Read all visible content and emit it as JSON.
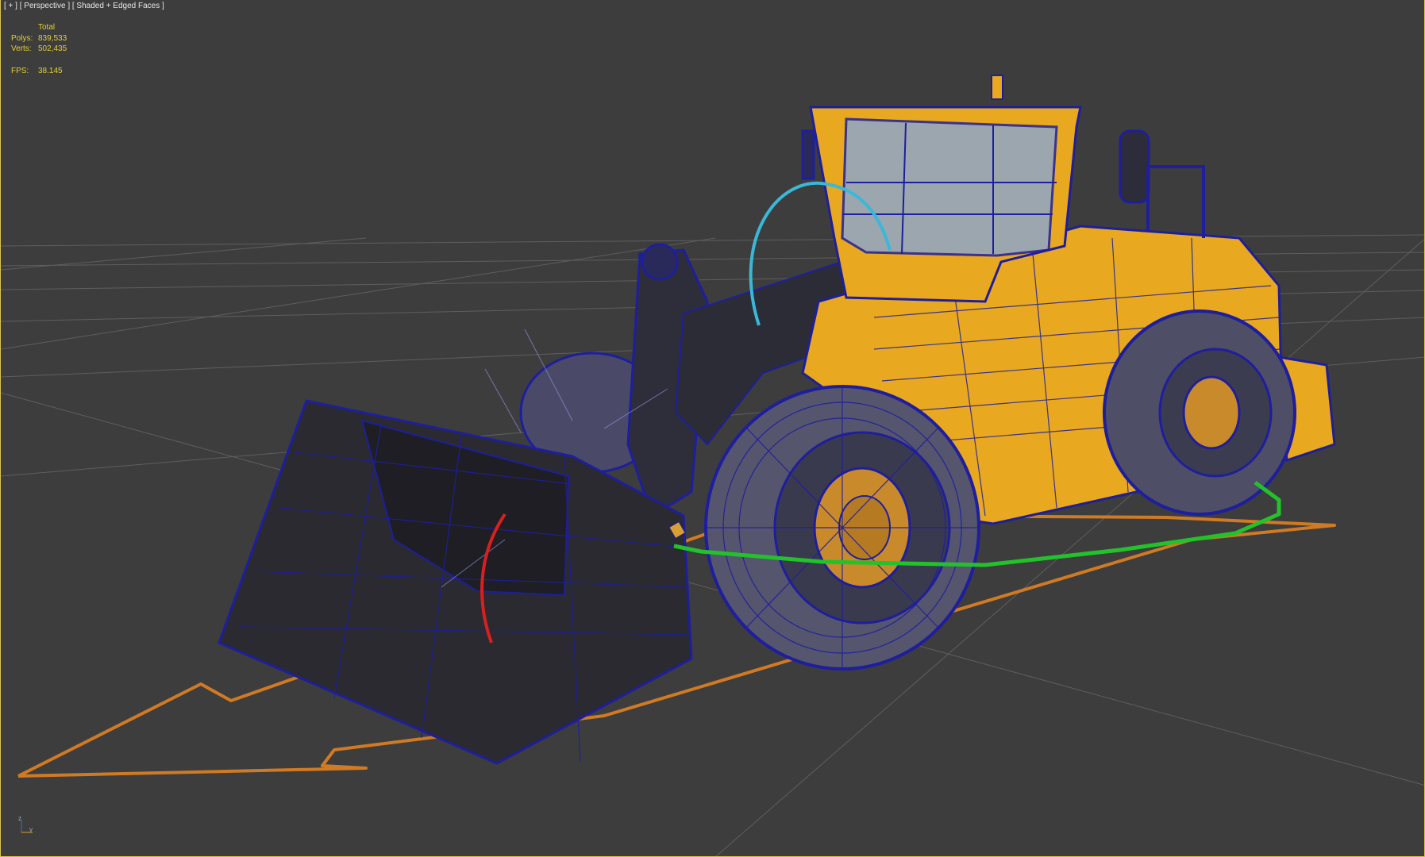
{
  "viewport": {
    "label_plus": "[ + ]",
    "label_view": "[ Perspective ]",
    "label_shading": "[ Shaded + Edged Faces ]"
  },
  "stats": {
    "header": "Total",
    "polys_label": "Polys:",
    "polys_value": "839,533",
    "verts_label": "Verts:",
    "verts_value": "502,435",
    "fps_label": "FPS:",
    "fps_value": "38.145"
  },
  "axis": {
    "z_label": "z",
    "y_label": "y"
  },
  "colors": {
    "background": "#3d3d3d",
    "grid": "#6a6a6a",
    "stats_text": "#e3cf3a",
    "wire": "#1e1e9e",
    "body": "#e8a820",
    "spline_orange": "#d07a24",
    "spline_green": "#22c22a",
    "spline_cyan": "#3ab8d8",
    "spline_red": "#d82020",
    "viewport_border": "#d9c54a"
  }
}
